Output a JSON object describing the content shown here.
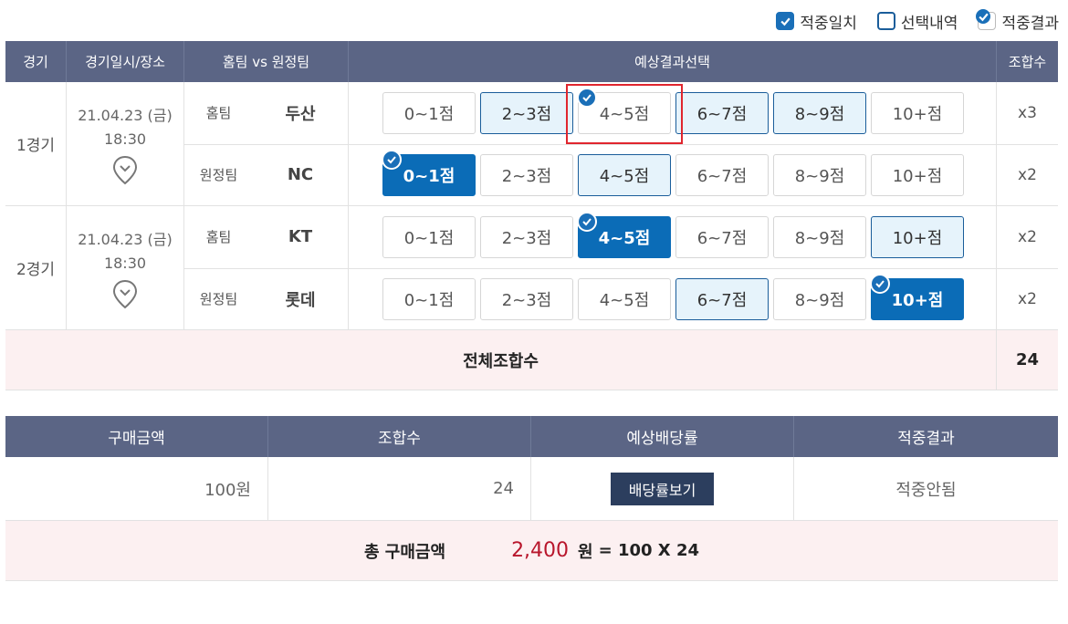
{
  "legend": {
    "hit": "적중일치",
    "selected": "선택내역",
    "result": "적중결과"
  },
  "table1": {
    "headers": {
      "game": "경기",
      "datetime": "경기일시/장소",
      "teams": "홈팀 vs 원정팀",
      "prediction": "예상결과선택",
      "combo": "조합수"
    },
    "games": [
      {
        "label": "1경기",
        "date": "21.04.23 (금)",
        "time": "18:30",
        "rows": [
          {
            "side": "홈팀",
            "team": "두산",
            "options": [
              {
                "label": "0~1점",
                "state": "none"
              },
              {
                "label": "2~3점",
                "state": "selected"
              },
              {
                "label": "4~5점",
                "state": "result"
              },
              {
                "label": "6~7점",
                "state": "selected"
              },
              {
                "label": "8~9점",
                "state": "selected"
              },
              {
                "label": "10+점",
                "state": "none"
              }
            ],
            "combo": "x3"
          },
          {
            "side": "원정팀",
            "team": "NC",
            "options": [
              {
                "label": "0~1점",
                "state": "hit"
              },
              {
                "label": "2~3점",
                "state": "none"
              },
              {
                "label": "4~5점",
                "state": "selected"
              },
              {
                "label": "6~7점",
                "state": "none"
              },
              {
                "label": "8~9점",
                "state": "none"
              },
              {
                "label": "10+점",
                "state": "none"
              }
            ],
            "combo": "x2"
          }
        ]
      },
      {
        "label": "2경기",
        "date": "21.04.23 (금)",
        "time": "18:30",
        "rows": [
          {
            "side": "홈팀",
            "team": "KT",
            "options": [
              {
                "label": "0~1점",
                "state": "none"
              },
              {
                "label": "2~3점",
                "state": "none"
              },
              {
                "label": "4~5점",
                "state": "hit"
              },
              {
                "label": "6~7점",
                "state": "none"
              },
              {
                "label": "8~9점",
                "state": "none"
              },
              {
                "label": "10+점",
                "state": "selected"
              }
            ],
            "combo": "x2"
          },
          {
            "side": "원정팀",
            "team": "롯데",
            "options": [
              {
                "label": "0~1점",
                "state": "none"
              },
              {
                "label": "2~3점",
                "state": "none"
              },
              {
                "label": "4~5점",
                "state": "none"
              },
              {
                "label": "6~7점",
                "state": "selected"
              },
              {
                "label": "8~9점",
                "state": "none"
              },
              {
                "label": "10+점",
                "state": "hit"
              }
            ],
            "combo": "x2"
          }
        ]
      }
    ],
    "total_label": "전체조합수",
    "total_value": "24"
  },
  "table2": {
    "headers": {
      "amount": "구매금액",
      "combo": "조합수",
      "odds": "예상배당률",
      "result": "적중결과"
    },
    "amount": "100원",
    "combo": "24",
    "odds_button": "배당률보기",
    "result": "적중안됨",
    "total_label": "총 구매금액",
    "total_amount": "2,400",
    "total_unit": "원",
    "total_formula": "= 100 X 24"
  },
  "colors": {
    "header_bg": "#5b6585",
    "hit_bg": "#0b6cb7",
    "selected_bg": "#e6f3fb",
    "total_bg": "#fcf0f1",
    "amount_red": "#b8162c",
    "highlight_red": "#e0262e"
  }
}
